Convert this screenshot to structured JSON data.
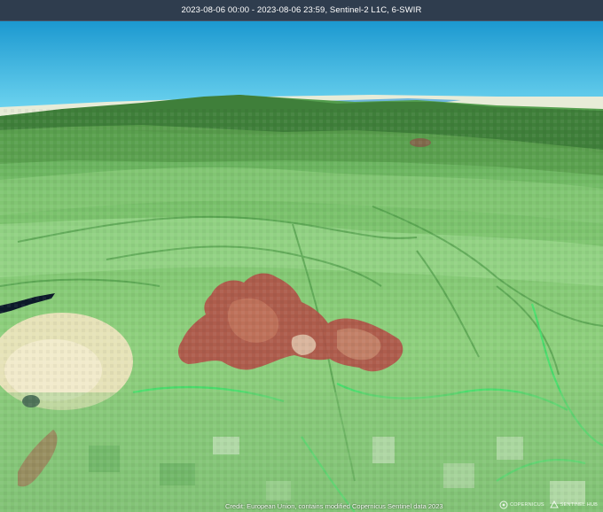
{
  "header": {
    "title": "2023-08-06 00:00 - 2023-08-06 23:59, Sentinel-2 L1C, 6-SWIR"
  },
  "footer": {
    "credit": "Credit: European Union, contains modified Copernicus Sentinel data 2023"
  },
  "logos": [
    {
      "name": "copernicus-logo",
      "text": "COPERNICUS"
    },
    {
      "name": "sentinel-hub-logo",
      "text": "SENTINEL HUB"
    }
  ],
  "colors": {
    "header_bg": "#2f3d4e",
    "sky_top": "#1fa0d6",
    "sky_horizon": "#6fd0ee",
    "vegetation": "#6fcf6a",
    "burn_scar": "#b8564a"
  }
}
